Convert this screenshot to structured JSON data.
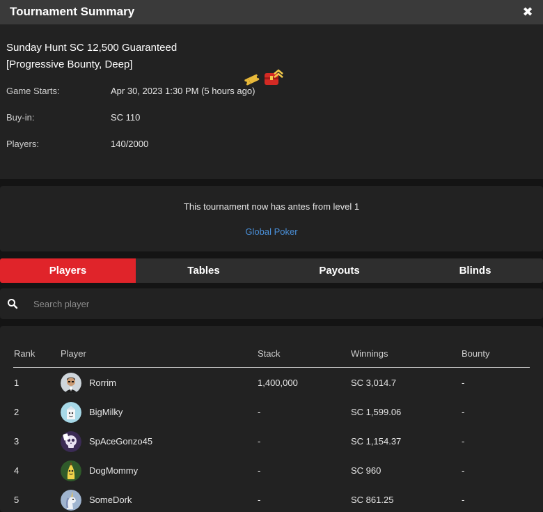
{
  "window": {
    "title": "Tournament Summary",
    "close_icon": "close-icon"
  },
  "tournament": {
    "name_line1": "Sunday Hunt SC 12,500 Guaranteed",
    "name_line2": "[Progressive Bounty, Deep]",
    "badges": [
      "ticket-icon",
      "progressive-bounty-icon"
    ]
  },
  "info": [
    {
      "label": "Game Starts:",
      "value": "Apr 30, 2023 1:30 PM (5 hours ago)"
    },
    {
      "label": "Buy-in:",
      "value": "SC 110"
    },
    {
      "label": "Players:",
      "value": "140/2000"
    }
  ],
  "notice": {
    "text": "This tournament now has antes from level 1",
    "link": "Global Poker"
  },
  "tabs": [
    {
      "label": "Players",
      "active": true
    },
    {
      "label": "Tables",
      "active": false
    },
    {
      "label": "Payouts",
      "active": false
    },
    {
      "label": "Blinds",
      "active": false
    }
  ],
  "search": {
    "placeholder": "Search player",
    "value": ""
  },
  "table": {
    "headers": {
      "rank": "Rank",
      "player": "Player",
      "stack": "Stack",
      "winnings": "Winnings",
      "bounty": "Bounty"
    },
    "rows": [
      {
        "rank": "1",
        "player": "Rorrim",
        "stack": "1,400,000",
        "winnings": "SC 3,014.7",
        "bounty": "-",
        "avatar": "man-in-suit-avatar"
      },
      {
        "rank": "2",
        "player": "BigMilky",
        "stack": "-",
        "winnings": "SC 1,599.06",
        "bounty": "-",
        "avatar": "milk-carton-avatar"
      },
      {
        "rank": "3",
        "player": "SpAceGonzo45",
        "stack": "-",
        "winnings": "SC 1,154.37",
        "bounty": "-",
        "avatar": "skull-ace-avatar"
      },
      {
        "rank": "4",
        "player": "DogMommy",
        "stack": "-",
        "winnings": "SC 960",
        "bounty": "-",
        "avatar": "banana-avatar"
      },
      {
        "rank": "5",
        "player": "SomeDork",
        "stack": "-",
        "winnings": "SC 861.25",
        "bounty": "-",
        "avatar": "unicorn-avatar"
      }
    ]
  },
  "colors": {
    "accent_tab": "#e0242a",
    "link": "#4a90d9",
    "panel": "#222222",
    "background": "#141414"
  }
}
